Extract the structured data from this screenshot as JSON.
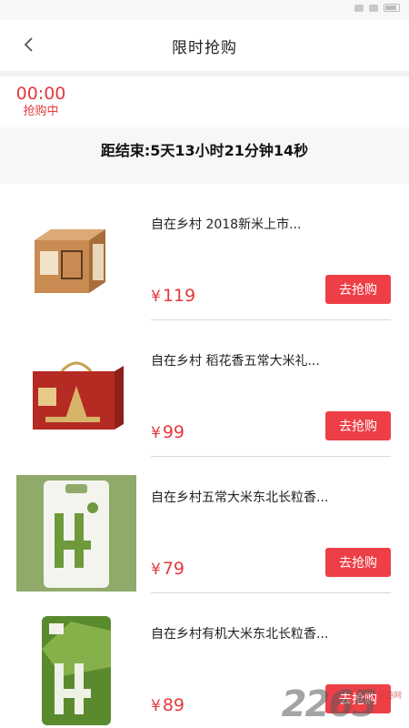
{
  "header": {
    "title": "限时抢购",
    "back_icon": "chevron-left-icon"
  },
  "time_tab": {
    "time": "00:00",
    "status": "抢购中"
  },
  "countdown": {
    "text": "距结束:5天13小时21分钟14秒"
  },
  "products": [
    {
      "name": "自在乡村 2018新米上市...",
      "currency": "¥",
      "price": "119",
      "button": "去抢购"
    },
    {
      "name": "自在乡村 稻花香五常大米礼...",
      "currency": "¥",
      "price": "99",
      "button": "去抢购"
    },
    {
      "name": "自在乡村五常大米东北长粒香...",
      "currency": "¥",
      "price": "79",
      "button": "去抢购"
    },
    {
      "name": "自在乡村有机大米东北长粒香...",
      "currency": "¥",
      "price": "89",
      "button": "去抢购"
    }
  ],
  "watermark": {
    "number": "2265",
    "sub": "手游网"
  },
  "colors": {
    "accent": "#e4393c",
    "button": "#ee3f47"
  }
}
